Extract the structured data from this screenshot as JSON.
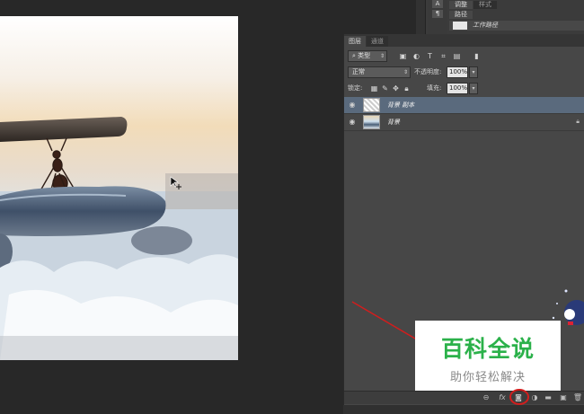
{
  "window": {
    "top_tabs": [
      "调整",
      "样式"
    ],
    "path_tab": "路径",
    "path_item": "工作路径"
  },
  "layers_panel": {
    "tabs": [
      "图层",
      "通道"
    ],
    "filter_select": "类型",
    "blend_mode": "正常",
    "opacity_label": "不透明度:",
    "opacity_value": "100%",
    "lock_label": "锁定:",
    "fill_label": "填充:",
    "fill_value": "100%",
    "layers": [
      {
        "name": "背景 副本",
        "selected": true,
        "thumb": "checker"
      },
      {
        "name": "背景",
        "selected": false,
        "thumb": "photo",
        "locked": true
      }
    ],
    "footer_icons": [
      "link-icon",
      "fx-icon",
      "mask-icon",
      "adjustment-icon",
      "folder-icon",
      "new-layer-icon",
      "trash-icon"
    ]
  },
  "watermark": {
    "title": "百科全说",
    "subtitle": "助你轻松解决",
    "title_color": "#2bb14a"
  },
  "colors": {
    "selected_layer": "#5a6a7d",
    "annotation_red": "#d21d1d"
  }
}
